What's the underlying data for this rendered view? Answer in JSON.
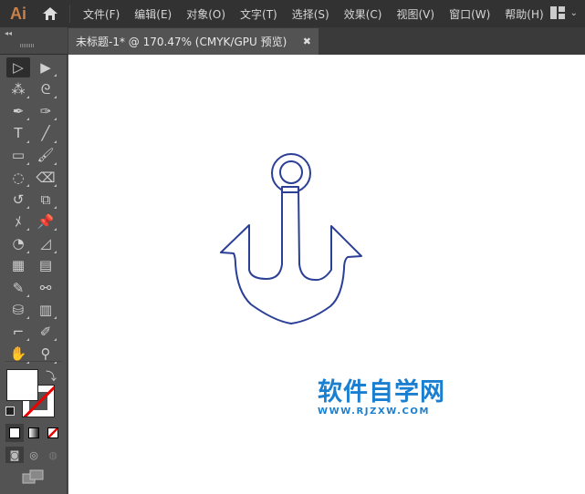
{
  "app": {
    "logo": "Ai"
  },
  "menu": [
    "文件(F)",
    "编辑(E)",
    "对象(O)",
    "文字(T)",
    "选择(S)",
    "效果(C)",
    "视图(V)",
    "窗口(W)",
    "帮助(H)"
  ],
  "document_tab": {
    "title": "未标题-1* @ 170.47% (CMYK/GPU 预览)",
    "close": "✖"
  },
  "tools": [
    [
      "selection-tool",
      "▷"
    ],
    [
      "direct-selection-tool",
      "▶"
    ],
    [
      "magic-wand-tool",
      "⁂"
    ],
    [
      "lasso-tool",
      "ᘓ"
    ],
    [
      "pen-tool",
      "✒"
    ],
    [
      "curvature-tool",
      "✑"
    ],
    [
      "type-tool",
      "T"
    ],
    [
      "line-segment-tool",
      "╱"
    ],
    [
      "rectangle-tool",
      "▭"
    ],
    [
      "paintbrush-tool",
      "🖌"
    ],
    [
      "shaper-tool",
      "◌"
    ],
    [
      "eraser-tool",
      "⌫"
    ],
    [
      "rotate-tool",
      "↺"
    ],
    [
      "scale-tool",
      "⧉"
    ],
    [
      "puppet-warp-tool",
      "ﾒ"
    ],
    [
      "pin-tool",
      "📌"
    ],
    [
      "shape-builder-tool",
      "◔"
    ],
    [
      "perspective-grid-tool",
      "◿"
    ],
    [
      "mesh-tool",
      "▦"
    ],
    [
      "gradient-tool",
      "▤"
    ],
    [
      "eyedropper-tool",
      "✎"
    ],
    [
      "blend-tool",
      "⚯"
    ],
    [
      "symbol-sprayer-tool",
      "⛁"
    ],
    [
      "column-graph-tool",
      "▥"
    ],
    [
      "artboard-tool",
      "⌐"
    ],
    [
      "slice-tool",
      "✐"
    ],
    [
      "hand-tool",
      "✋"
    ],
    [
      "zoom-tool",
      "⚲"
    ]
  ],
  "watermark": {
    "title": "软件自学网",
    "url": "WWW.RJZXW.COM"
  },
  "colors": {
    "anchor_stroke": "#2b3f96",
    "watermark": "#1a7fd0"
  }
}
